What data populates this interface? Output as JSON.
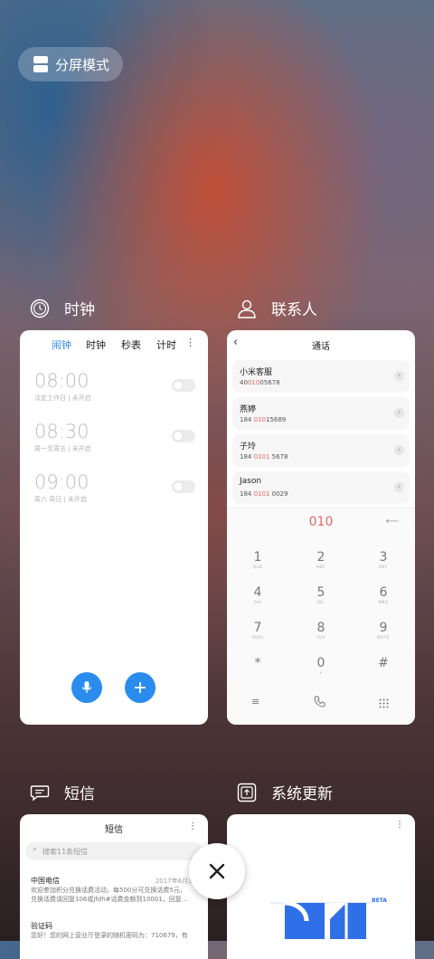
{
  "split_screen": {
    "label": "分屏模式"
  },
  "apps": {
    "clock": {
      "title": "时钟",
      "tabs": [
        "闹钟",
        "时钟",
        "秒表",
        "计时"
      ],
      "active_tab": "闹钟",
      "alarms": [
        {
          "time": "08:00",
          "desc": "法定工作日 | 未开启",
          "enabled": false
        },
        {
          "time": "08:30",
          "desc": "周一至周五 | 未开启",
          "enabled": false
        },
        {
          "time": "09:00",
          "desc": "周六 周日 | 未开启",
          "enabled": false
        }
      ]
    },
    "contacts": {
      "title": "联系人",
      "screen_title": "通话",
      "back_glyph": "‹",
      "list": [
        {
          "name": "小米客服",
          "pre": "40",
          "hl": "010",
          "post": "05678"
        },
        {
          "name": "燕婷",
          "pre": "184 ",
          "hl": "010",
          "post": "15689"
        },
        {
          "name": "子玲",
          "pre": "184 ",
          "hl": "0101",
          "post": " 5678"
        },
        {
          "name": "Jason",
          "pre": "184 ",
          "hl": "0101",
          "post": " 0029"
        }
      ],
      "dial_input": "010",
      "keypad": [
        {
          "d": "1",
          "l": "QLD"
        },
        {
          "d": "2",
          "l": "ABC"
        },
        {
          "d": "3",
          "l": "DEF"
        },
        {
          "d": "4",
          "l": "GHI"
        },
        {
          "d": "5",
          "l": "JKL"
        },
        {
          "d": "6",
          "l": "MNO"
        },
        {
          "d": "7",
          "l": "PQRS"
        },
        {
          "d": "8",
          "l": "TUV"
        },
        {
          "d": "9",
          "l": "WXYZ"
        },
        {
          "d": "*",
          "l": ""
        },
        {
          "d": "0",
          "l": "+"
        },
        {
          "d": "#",
          "l": ""
        }
      ]
    },
    "messages": {
      "title": "短信",
      "screen_title": "短信",
      "search_placeholder": "搜索11条短信",
      "items": [
        {
          "sender": "中国电信",
          "date": "2017年6月30日",
          "body1": "欢迎参加积分兑换话费活动，每500分可兑换话费5元，",
          "body2": "兑换话费请回复106或jfdh#话费金额到10001，回复..."
        },
        {
          "sender": "验证码",
          "date": "",
          "body1": "您好！您的网上营业厅登录的随机密码为：710679，有",
          "body2": ""
        }
      ]
    },
    "updater": {
      "title": "系统更新",
      "beta_label": "BETA"
    }
  },
  "colors": {
    "accent": "#2b8cf0",
    "highlight": "#e66666"
  }
}
